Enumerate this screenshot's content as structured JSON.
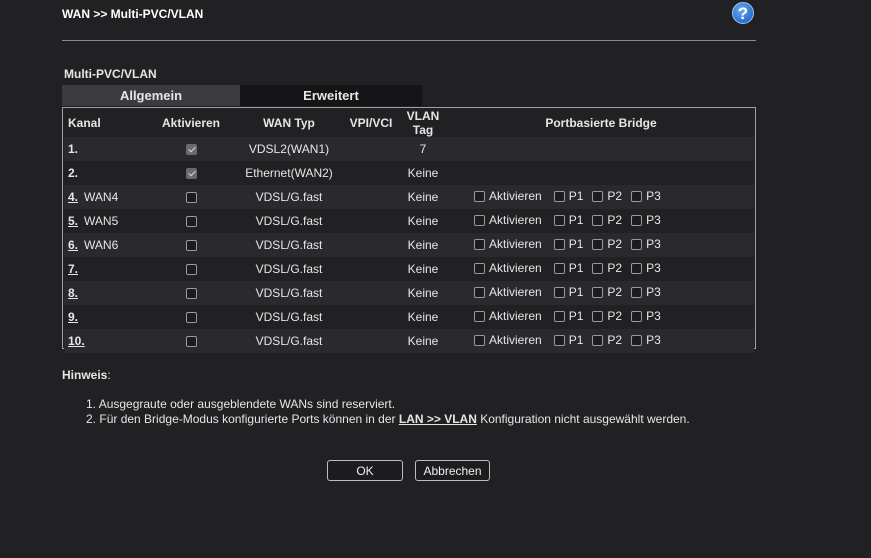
{
  "header": {
    "title": "WAN >> Multi-PVC/VLAN",
    "help_icon": "?"
  },
  "section": {
    "title": "Multi-PVC/VLAN"
  },
  "tabs": [
    {
      "label": "Allgemein",
      "active": true
    },
    {
      "label": "Erweitert",
      "active": false
    }
  ],
  "table": {
    "headers": {
      "kanal": "Kanal",
      "aktivieren": "Aktivieren",
      "wan_typ": "WAN Typ",
      "vpi_vci": "VPI/VCI",
      "vlan_tag": "VLAN Tag",
      "bridge": "Portbasierte Bridge"
    },
    "rows": [
      {
        "num": "1.",
        "link": false,
        "name": "",
        "checked": true,
        "disabled": true,
        "wan_type": "VDSL2(WAN1)",
        "vpi": "",
        "vlan": "7",
        "bridge": false
      },
      {
        "num": "2.",
        "link": false,
        "name": "",
        "checked": true,
        "disabled": true,
        "wan_type": "Ethernet(WAN2)",
        "vpi": "",
        "vlan": "Keine",
        "bridge": false
      },
      {
        "num": "4.",
        "link": true,
        "name": "WAN4",
        "checked": false,
        "disabled": false,
        "wan_type": "VDSL/G.fast",
        "vpi": "",
        "vlan": "Keine",
        "bridge": true
      },
      {
        "num": "5.",
        "link": true,
        "name": "WAN5",
        "checked": false,
        "disabled": false,
        "wan_type": "VDSL/G.fast",
        "vpi": "",
        "vlan": "Keine",
        "bridge": true
      },
      {
        "num": "6.",
        "link": true,
        "name": "WAN6",
        "checked": false,
        "disabled": false,
        "wan_type": "VDSL/G.fast",
        "vpi": "",
        "vlan": "Keine",
        "bridge": true
      },
      {
        "num": "7.",
        "link": true,
        "name": "",
        "checked": false,
        "disabled": false,
        "wan_type": "VDSL/G.fast",
        "vpi": "",
        "vlan": "Keine",
        "bridge": true
      },
      {
        "num": "8.",
        "link": true,
        "name": "",
        "checked": false,
        "disabled": false,
        "wan_type": "VDSL/G.fast",
        "vpi": "",
        "vlan": "Keine",
        "bridge": true
      },
      {
        "num": "9.",
        "link": true,
        "name": "",
        "checked": false,
        "disabled": false,
        "wan_type": "VDSL/G.fast",
        "vpi": "",
        "vlan": "Keine",
        "bridge": true
      },
      {
        "num": "10.",
        "link": true,
        "name": "",
        "checked": false,
        "disabled": false,
        "wan_type": "VDSL/G.fast",
        "vpi": "",
        "vlan": "Keine",
        "bridge": true
      }
    ],
    "bridge_labels": {
      "enable": "Aktivieren",
      "p1": "P1",
      "p2": "P2",
      "p3": "P3"
    }
  },
  "notes": {
    "title": "Hinweis",
    "colon": ":",
    "items": [
      {
        "num": "1.",
        "before": "Ausgegraute oder ausgeblendete WANs sind reserviert.",
        "link": "",
        "after": ""
      },
      {
        "num": "2.",
        "before": "Für den Bridge-Modus konfigurierte Ports können in der ",
        "link": "LAN >> VLAN",
        "after": " Konfiguration nicht ausgewählt werden."
      }
    ]
  },
  "buttons": {
    "ok": "OK",
    "cancel": "Abbrechen"
  }
}
